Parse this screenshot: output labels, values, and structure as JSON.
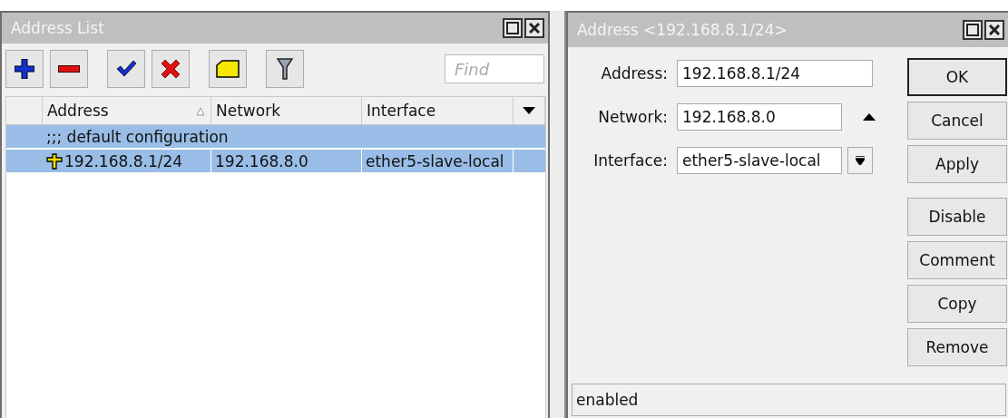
{
  "address_list": {
    "title": "Address List",
    "toolbar": [
      {
        "kind": "add"
      },
      {
        "kind": "remove"
      },
      {
        "kind": "enable"
      },
      {
        "kind": "disable"
      },
      {
        "kind": "comment"
      },
      {
        "kind": "filter"
      }
    ],
    "search": {
      "placeholder": "Find"
    },
    "columns": [
      {
        "label": "Address",
        "sorted": true
      },
      {
        "label": "Network",
        "sorted": false
      },
      {
        "label": "Interface",
        "sorted": false
      }
    ],
    "rows": [
      {
        "kind": "comment",
        "text": ";;; default configuration",
        "selected": true
      },
      {
        "kind": "address",
        "cells": [
          "192.168.8.1/24",
          "192.168.8.0",
          "ether5-slave-local"
        ],
        "selected": true
      }
    ]
  },
  "address_dialog": {
    "title": "Address <192.168.8.1/24>",
    "fields": [
      {
        "label": "Address:",
        "value": "192.168.8.1/24",
        "kind": "text"
      },
      {
        "label": "Network:",
        "value": "192.168.8.0",
        "kind": "toggle"
      },
      {
        "label": "Interface:",
        "value": "ether5-slave-local",
        "kind": "dropdown"
      }
    ],
    "button_groups": [
      [
        {
          "label": "OK",
          "default": true
        },
        {
          "label": "Cancel",
          "default": false
        },
        {
          "label": "Apply",
          "default": false
        }
      ],
      [
        {
          "label": "Disable",
          "default": false
        },
        {
          "label": "Comment",
          "default": false
        },
        {
          "label": "Copy",
          "default": false
        },
        {
          "label": "Remove",
          "default": false
        }
      ]
    ],
    "status": "enabled"
  }
}
